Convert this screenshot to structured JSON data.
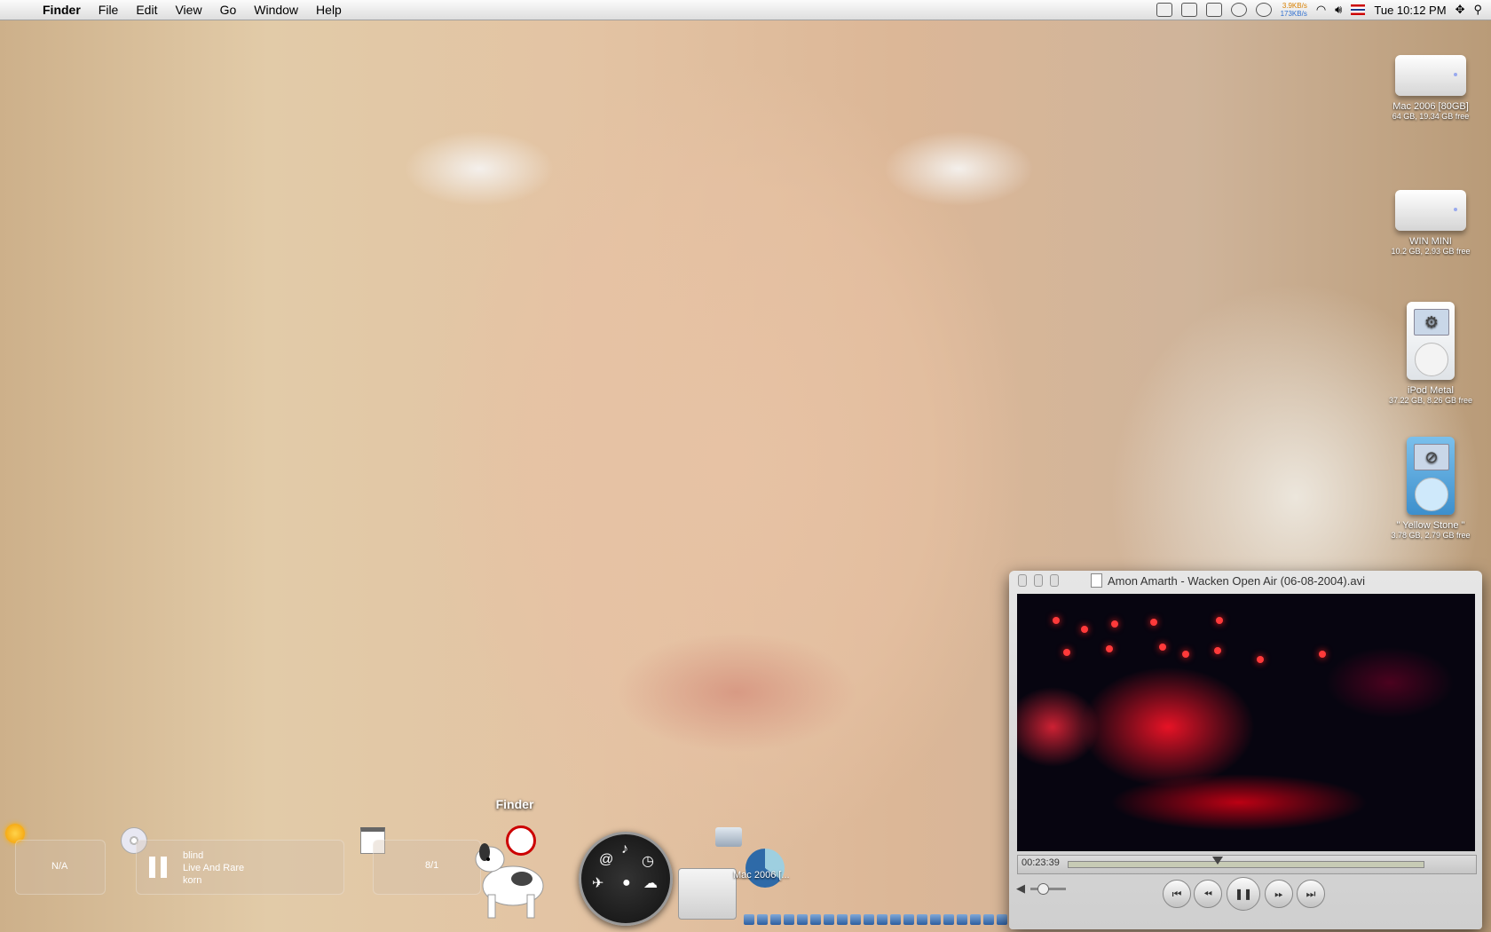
{
  "menubar": {
    "apple": "",
    "items": [
      "Finder",
      "File",
      "Edit",
      "View",
      "Go",
      "Window",
      "Help"
    ],
    "net_up": "3.9KB/s",
    "net_down": "173KB/s",
    "clock": "Tue 10:12 PM"
  },
  "desktop": {
    "icons": [
      {
        "name": "Mac 2006 [80GB]",
        "sub": "64 GB, 19.34 GB free"
      },
      {
        "name": "WIN MINI",
        "sub": "10.2 GB, 2.93 GB free"
      },
      {
        "name": "iPod Metal",
        "sub": "37.22 GB, 8.26 GB free"
      },
      {
        "name": "\" Yellow Stone \"",
        "sub": "3.78 GB, 2.79 GB free"
      }
    ]
  },
  "widgets": {
    "weather": "N/A",
    "itunes": {
      "track": "blind",
      "album": "Live And Rare",
      "artist": "korn"
    },
    "calendar": "8/1"
  },
  "dock": {
    "finder_label": "Finder",
    "drive_label": "Mac 2006 [..."
  },
  "player": {
    "title": "Amon Amarth - Wacken Open Air (06-08-2004).avi",
    "timecode": "00:23:39",
    "progress": 0.42
  }
}
